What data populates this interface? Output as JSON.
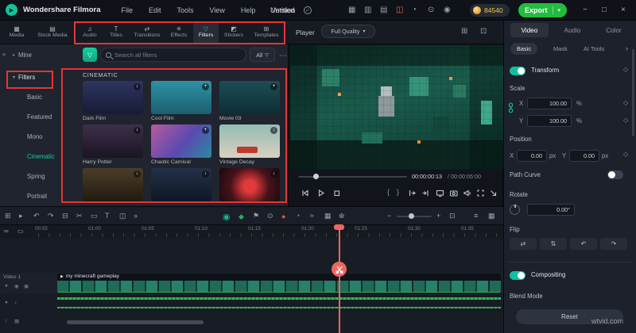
{
  "menubar": {
    "brand": "Wondershare Filmora",
    "items": [
      "File",
      "Edit",
      "Tools",
      "View",
      "Help",
      "Version"
    ],
    "project": "Untitled",
    "coins": "84540",
    "export_label": "Export"
  },
  "toolbar": {
    "media": "Media",
    "stock": "Stock Media",
    "tabs": [
      "Audio",
      "Titles",
      "Transitions",
      "Effects",
      "Filters",
      "Stickers",
      "Templates"
    ],
    "active_tab": "Filters"
  },
  "player": {
    "label": "Player",
    "quality": "Full Quality",
    "time_current": "00:00:00:13",
    "time_total": " / 00:00:05:00"
  },
  "sidebar": {
    "mine": "Mine",
    "filters": "Filters",
    "children": [
      "Basic",
      "Featured",
      "Mono",
      "Cinematic",
      "Spring",
      "Portrait"
    ],
    "active_child": "Cinematic"
  },
  "filters_panel": {
    "search_placeholder": "Search all filters",
    "all_label": "All",
    "section": "CINEMATIC",
    "items": [
      {
        "name": "Dark Film"
      },
      {
        "name": "Cool Film"
      },
      {
        "name": "Movie 03"
      },
      {
        "name": "Harry Potter"
      },
      {
        "name": "Chaotic Carnival"
      },
      {
        "name": "Vintage Decay"
      },
      {
        "name": ""
      },
      {
        "name": ""
      },
      {
        "name": ""
      }
    ]
  },
  "properties": {
    "tabs": [
      "Video",
      "Audio",
      "Color"
    ],
    "subtabs": [
      "Basic",
      "Mask",
      "AI Tools"
    ],
    "transform_label": "Transform",
    "scale_label": "Scale",
    "x_label": "X",
    "y_label": "Y",
    "scale_x": "100.00",
    "scale_y": "100.00",
    "percent": "%",
    "position_label": "Position",
    "pos_x": "0.00",
    "pos_y": "0.00",
    "px": "px",
    "path_curve_label": "Path Curve",
    "rotate_label": "Rotate",
    "angle": "0.00°",
    "flip_label": "Flip",
    "compositing_label": "Compositing",
    "blend_mode_label": "Blend Mode",
    "reset_label": "Reset"
  },
  "timeline": {
    "ruler": [
      "00:55",
      "01:00",
      "01:05",
      "01:10",
      "01:15",
      "01:20",
      "01:25",
      "01:30",
      "01:35"
    ],
    "video_track_label": "Video 1",
    "clip_name": "my minecraft gameplay"
  },
  "watermark": "wtvid.com",
  "colors": {
    "accent_teal": "#14c5a0",
    "export_green": "#22bd3e",
    "annotation_red": "#e23636",
    "playhead_red": "#ee6660",
    "audio_green": "#34b257",
    "coin_orange": "#f2a93b"
  },
  "icons": {
    "logo_play": "▶",
    "project_check": "✓",
    "dropdown_caret": "▾",
    "minimize": "−",
    "maximize": "□",
    "close": "×",
    "store": "▦",
    "device": "▥",
    "panel_layout": "▤",
    "resource": "◫",
    "notify": "◔",
    "settings": "⊙",
    "avatar": "◉",
    "media": "▦",
    "stock_media": "▤",
    "audio": "♫",
    "titles": "T",
    "transitions": "⇄",
    "effects": "✳",
    "filters": "▽",
    "stickers": "◩",
    "templates": "⊞",
    "collapse": "«",
    "chevron_right": "▸",
    "chevron_down": "▾",
    "chevron_more": "›",
    "funnel": "▽",
    "more": "⋯",
    "download": "↓",
    "add": "+",
    "grid_view": "⊞",
    "expand_view": "⊡",
    "brace_in": "{",
    "brace_out": "}",
    "select": "▸",
    "undo": "↶",
    "redo": "↷",
    "delete": "⊟",
    "split": "✂",
    "crop": "▭",
    "text_tool": "T",
    "pip": "◫",
    "tools_more": "»",
    "motion": "◉",
    "keyframe": "◆",
    "marker": "⚑",
    "voiceover": "⊙",
    "record": "●",
    "speed": "◔",
    "mixer": "≈",
    "tracks": "▦",
    "add_track": "⊕",
    "zoom_out": "−",
    "zoom_in": "+",
    "fit": "⊡",
    "list": "≡",
    "link": "∞",
    "boxselect": "▭",
    "diamond": "◇",
    "mute": "●",
    "eye": "◉",
    "lock": "▣",
    "note": "♪",
    "flip_h": "⇄",
    "flip_v": "⇅",
    "rotate_ccw": "↶",
    "rotate_cw": "↷"
  }
}
